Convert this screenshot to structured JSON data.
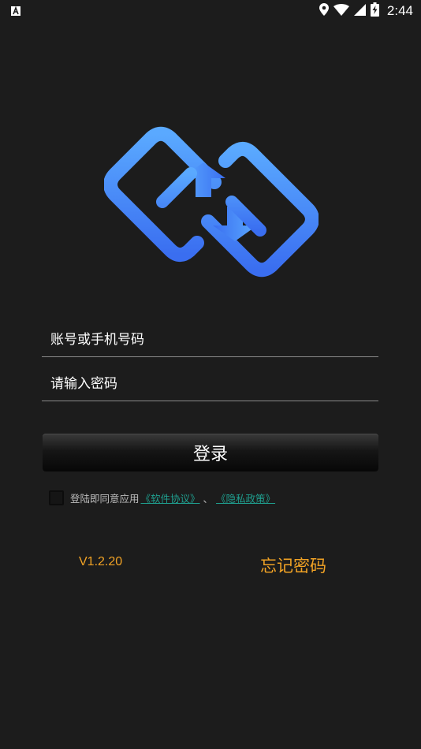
{
  "status_bar": {
    "time": "2:44",
    "left_icon": "a-notification-icon",
    "icons": [
      "location-icon",
      "wifi-icon",
      "signal-icon",
      "battery-charging-icon"
    ]
  },
  "logo": {
    "icon": "link-arrows-logo-icon",
    "color_start": "#5aa9ff",
    "color_end": "#3a6ef0"
  },
  "form": {
    "account_placeholder": "账号或手机号码",
    "password_placeholder": "请输入密码",
    "login_label": "登录"
  },
  "agreement": {
    "checked": false,
    "prefix": "登陆即同意应用",
    "software_link": "《软件协议》",
    "separator": "、",
    "privacy_link": "《隐私政策》"
  },
  "footer": {
    "version": "V1.2.20",
    "forgot_password": "忘记密码"
  },
  "colors": {
    "background": "#1c1c1c",
    "accent": "#f2a325",
    "link": "#1f9e8e"
  }
}
